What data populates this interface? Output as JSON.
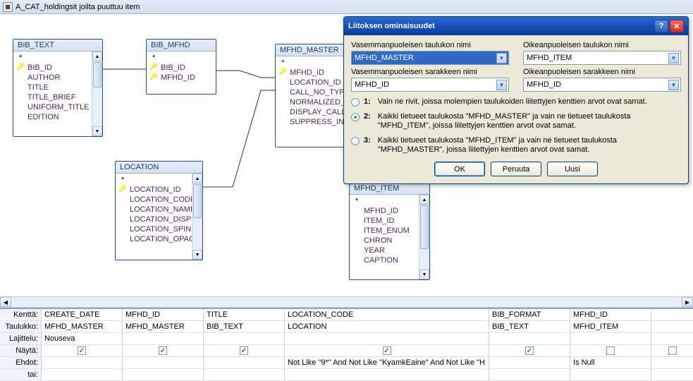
{
  "window": {
    "title": "A_CAT_holdingsit joilta puuttuu item"
  },
  "tables": {
    "bib_text": {
      "title": "BIB_TEXT",
      "fields": [
        "*",
        "BIB_ID",
        "AUTHOR",
        "TITLE",
        "TITLE_BRIEF",
        "UNIFORM_TITLE",
        "EDITION"
      ]
    },
    "bib_mfhd": {
      "title": "BIB_MFHD",
      "fields": [
        "*",
        "BIB_ID",
        "MFHD_ID"
      ]
    },
    "mfhd_master": {
      "title": "MFHD_MASTER",
      "fields": [
        "*",
        "MFHD_ID",
        "LOCATION_ID",
        "CALL_NO_TYPE",
        "NORMALIZED_CA",
        "DISPLAY_CALL_NO",
        "SUPPRESS_IN_OP"
      ]
    },
    "location": {
      "title": "LOCATION",
      "fields": [
        "*",
        "LOCATION_ID",
        "LOCATION_CODE",
        "LOCATION_NAME",
        "LOCATION_DISPLA",
        "LOCATION_SPINE",
        "LOCATION_OPAC"
      ]
    },
    "mfhd_item": {
      "title": "MFHD_ITEM",
      "fields": [
        "*",
        "MFHD_ID",
        "ITEM_ID",
        "ITEM_ENUM",
        "CHRON",
        "YEAR",
        "CAPTION"
      ]
    }
  },
  "dialog": {
    "title": "Liitoksen ominaisuudet",
    "left_table_label": "Vasemmanpuoleisen taulukon nimi",
    "right_table_label": "Oikeanpuoleisen taulukon nimi",
    "left_col_label": "Vasemmanpuoleisen sarakkeen nimi",
    "right_col_label": "Oikeanpuoleisen sarakkeen nimi",
    "left_table": "MFHD_MASTER",
    "right_table": "MFHD_ITEM",
    "left_col": "MFHD_ID",
    "right_col": "MFHD_ID",
    "opt1_label": "1:",
    "opt1_text": "Vain ne rivit, joissa molempien taulukoiden liitettyjen kenttien arvot ovat samat.",
    "opt2_label": "2:",
    "opt2_text": "Kaikki tietueet taulukosta \"MFHD_MASTER\" ja vain ne tietueet taulukosta \"MFHD_ITEM\", joissa liitettyjen kenttien arvot ovat samat.",
    "opt3_label": "3:",
    "opt3_text": "Kaikki tietueet taulukosta \"MFHD_ITEM\" ja vain ne tietueet taulukosta \"MFHD_MASTER\", joissa liitettyjen kenttien arvot ovat samat.",
    "ok": "OK",
    "cancel": "Peruuta",
    "new": "Uusi"
  },
  "grid": {
    "row_labels": [
      "Kenttä:",
      "Taulukko:",
      "Lajittelu:",
      "Näytä:",
      "Ehdot:",
      "tai:"
    ],
    "columns": [
      {
        "field": "CREATE_DATE",
        "table": "MFHD_MASTER",
        "sort": "Nouseva",
        "show": true,
        "criteria": "",
        "or": ""
      },
      {
        "field": "MFHD_ID",
        "table": "MFHD_MASTER",
        "sort": "",
        "show": true,
        "criteria": "",
        "or": ""
      },
      {
        "field": "TITLE",
        "table": "BIB_TEXT",
        "sort": "",
        "show": true,
        "criteria": "",
        "or": ""
      },
      {
        "field": "LOCATION_CODE",
        "table": "LOCATION",
        "sort": "",
        "show": true,
        "criteria": "Not Like \"9*\" And Not Like \"KyamkEaine\" And Not Like \"H",
        "or": ""
      },
      {
        "field": "BIB_FORMAT",
        "table": "BIB_TEXT",
        "sort": "",
        "show": true,
        "criteria": "",
        "or": ""
      },
      {
        "field": "MFHD_ID",
        "table": "MFHD_ITEM",
        "sort": "",
        "show": false,
        "criteria": "Is Null",
        "or": ""
      }
    ]
  }
}
